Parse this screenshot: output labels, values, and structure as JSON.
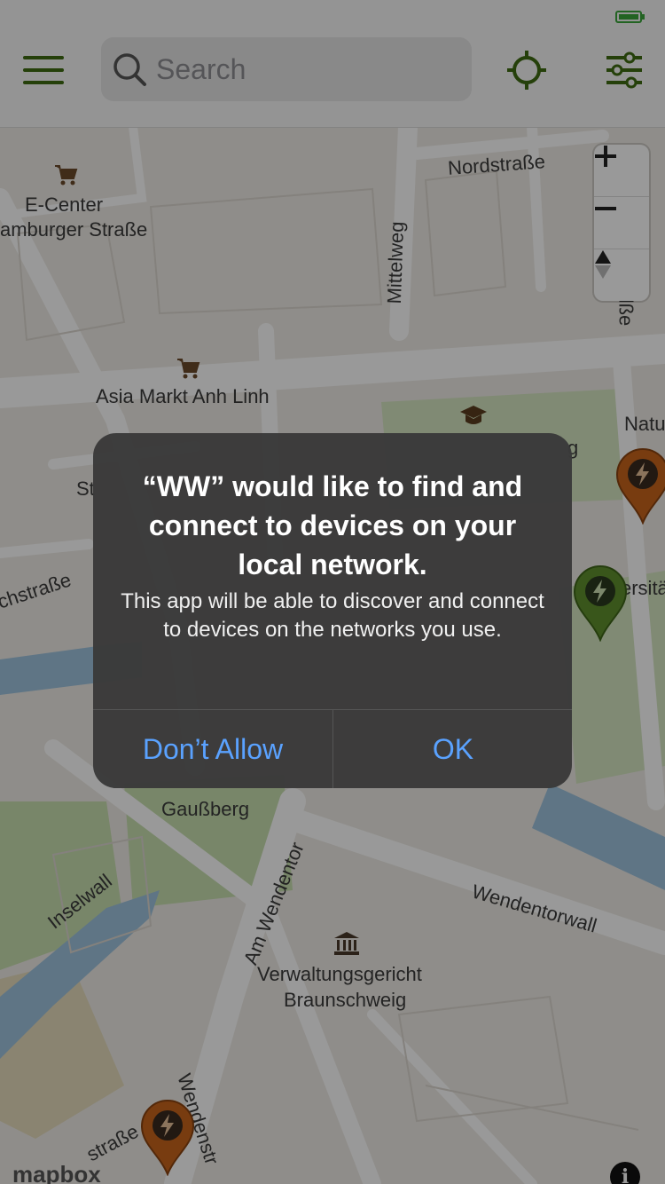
{
  "header": {
    "search_placeholder": "Search"
  },
  "map": {
    "labels": {
      "nordstrasse": "Nordstraße",
      "e_center": "E-Center",
      "hamburger_strasse": "amburger Straße",
      "mittelweg": "Mittelweg",
      "asia_markt": "Asia Markt Anh Linh",
      "natu": "Natu",
      "ersita": "ersitä",
      "st": "St",
      "chstrasse": "chstraße",
      "gaussberg": "Gaußberg",
      "inselwall": "Inselwall",
      "am_wendentor": "Am Wendentor",
      "wendentorwall": "Wendentorwall",
      "verwaltungsgericht_1": "Verwaltungsgericht",
      "verwaltungsgericht_2": "Braunschweig",
      "wendenstr": "Wendenstr",
      "strasse_bottom": "straße",
      "g": "g",
      "lsse": "lße"
    },
    "attribution": "mapbox",
    "info_symbol": "i",
    "pin_colors": {
      "orange": "#c8651c",
      "green": "#5f8f2d"
    }
  },
  "dialog": {
    "title": "“WW” would like to find and connect to devices on your local network.",
    "message": "This app will be able to discover and connect to devices on the networks you use.",
    "deny_label": "Don’t Allow",
    "ok_label": "OK"
  },
  "colors": {
    "accent": "#3e6b12",
    "dialog_button": "#5aa2ff"
  }
}
